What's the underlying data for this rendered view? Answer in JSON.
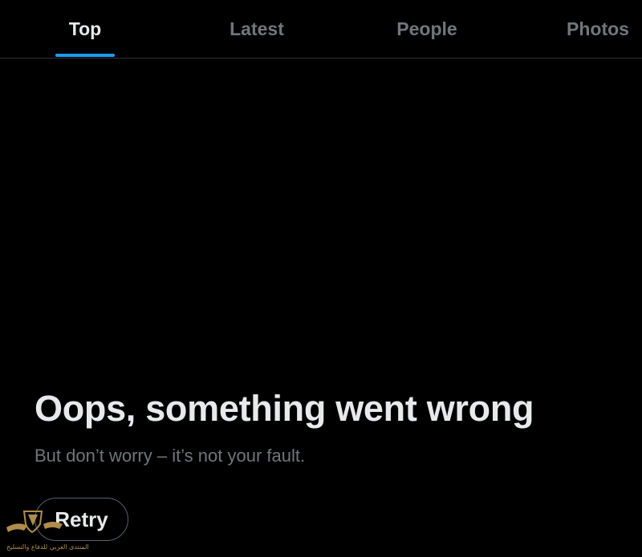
{
  "tabs": [
    {
      "label": "Top",
      "active": true
    },
    {
      "label": "Latest",
      "active": false
    },
    {
      "label": "People",
      "active": false
    },
    {
      "label": "Photos",
      "active": false
    }
  ],
  "error": {
    "title": "Oops, something went wrong",
    "subtitle": "But don’t worry – it’s not your fault.",
    "retry_label": "Retry"
  },
  "colors": {
    "background": "#000000",
    "accent": "#1d9bf0",
    "text_primary": "#e7e9ea",
    "text_secondary": "#71767b",
    "watermark": "#b08d4a"
  },
  "watermark": {
    "icon": "shield-wings-logo",
    "caption": "المنتدى العربي للدفاع والتسليح"
  }
}
